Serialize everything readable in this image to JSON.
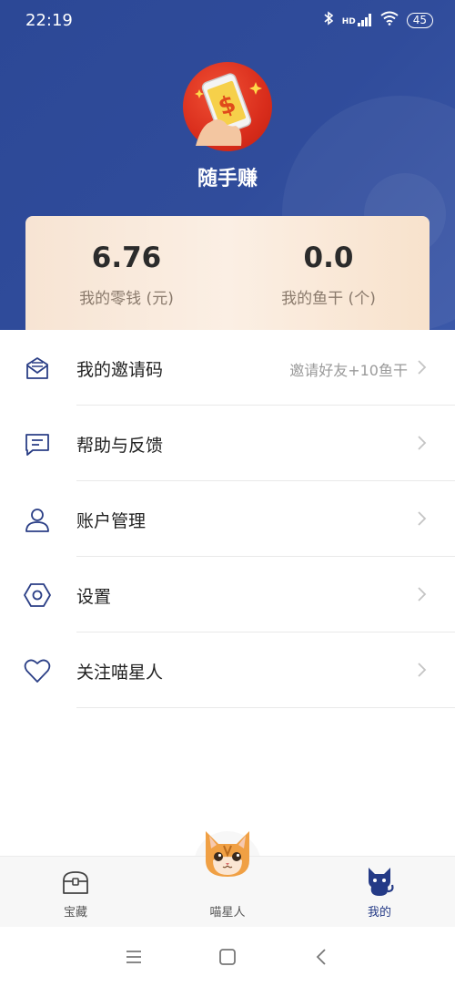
{
  "status_bar": {
    "time": "22:19",
    "battery": "45",
    "network": "HD"
  },
  "app": {
    "title": "随手赚"
  },
  "balance": {
    "change_value": "6.76",
    "change_label": "我的零钱 (元)",
    "fish_value": "0.0",
    "fish_label": "我的鱼干 (个)"
  },
  "menu": {
    "items": [
      {
        "label": "我的邀请码",
        "icon": "envelope-icon",
        "right_text": "邀请好友+10鱼干"
      },
      {
        "label": "帮助与反馈",
        "icon": "message-icon"
      },
      {
        "label": "账户管理",
        "icon": "user-icon"
      },
      {
        "label": "设置",
        "icon": "hexagon-settings-icon"
      },
      {
        "label": "关注喵星人",
        "icon": "heart-icon"
      }
    ]
  },
  "tabs": [
    {
      "label": "宝藏",
      "icon": "treasure-chest-icon",
      "active": false
    },
    {
      "label": "喵星人",
      "icon": "cat-face-icon",
      "active": false
    },
    {
      "label": "我的",
      "icon": "cat-silhouette-icon",
      "active": true
    }
  ],
  "colors": {
    "header": "#2f4b99",
    "accent": "#243a86",
    "card": "#f8e6d5"
  }
}
